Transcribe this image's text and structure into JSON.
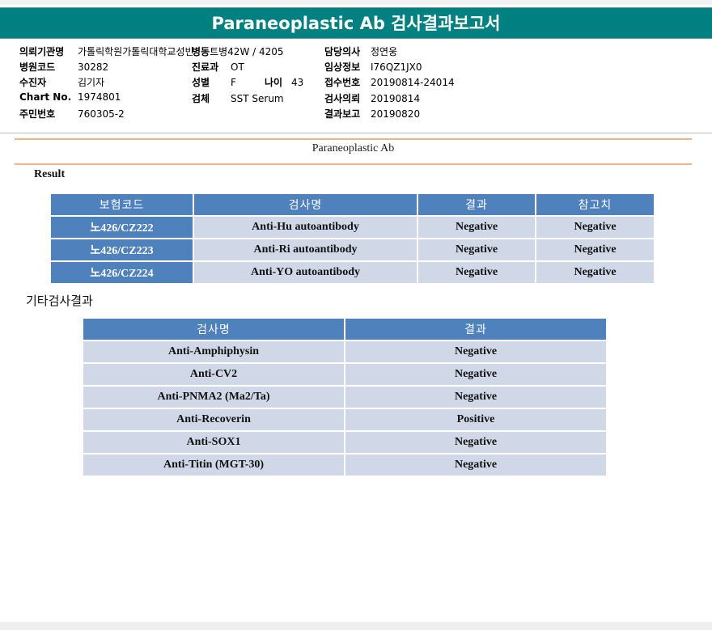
{
  "title": "Paraneoplastic Ab 검사결과보고서",
  "info": {
    "col1": [
      {
        "label": "의뢰기관명",
        "value": "가톨릭학원가톨릭대학교성빈"
      },
      {
        "label": "병원코드",
        "value": "30282"
      },
      {
        "label": "수진자",
        "value": "김기자"
      },
      {
        "label": "Chart No.",
        "value": "1974801"
      },
      {
        "label": "주민번호",
        "value": "760305-2"
      }
    ],
    "col2": [
      {
        "label": "병동",
        "value": "트병42W / 4205"
      },
      {
        "label": "진료과",
        "value": "OT"
      },
      {
        "label": "성별",
        "value": "F",
        "label2": "나이",
        "value2": "43"
      },
      {
        "label": "검체",
        "value": "SST Serum"
      }
    ],
    "col3": [
      {
        "label": "담당의사",
        "value": "정연웅"
      },
      {
        "label": "임상정보",
        "value": "I76QZ1JX0"
      },
      {
        "label": "접수번호",
        "value": "20190814-24014"
      },
      {
        "label": "검사의뢰",
        "value": "20190814"
      },
      {
        "label": "결과보고",
        "value": "20190820"
      }
    ]
  },
  "section_title": "Paraneoplastic Ab",
  "result_label": "Result",
  "result_table": {
    "headers": [
      "보험코드",
      "검사명",
      "결과",
      "참고치"
    ],
    "rows": [
      [
        "노426/CZ222",
        "Anti-Hu autoantibody",
        "Negative",
        "Negative"
      ],
      [
        "노426/CZ223",
        "Anti-Ri autoantibody",
        "Negative",
        "Negative"
      ],
      [
        "노426/CZ224",
        "Anti-YO autoantibody",
        "Negative",
        "Negative"
      ]
    ]
  },
  "other_label": "기타검사결과",
  "other_table": {
    "headers": [
      "검사명",
      "결과"
    ],
    "rows": [
      [
        "Anti-Amphiphysin",
        "Negative"
      ],
      [
        "Anti-CV2",
        "Negative"
      ],
      [
        "Anti-PNMA2 (Ma2/Ta)",
        "Negative"
      ],
      [
        "Anti-Recoverin",
        "Positive"
      ],
      [
        "Anti-SOX1",
        "Negative"
      ],
      [
        "Anti-Titin (MGT-30)",
        "Negative"
      ]
    ]
  }
}
